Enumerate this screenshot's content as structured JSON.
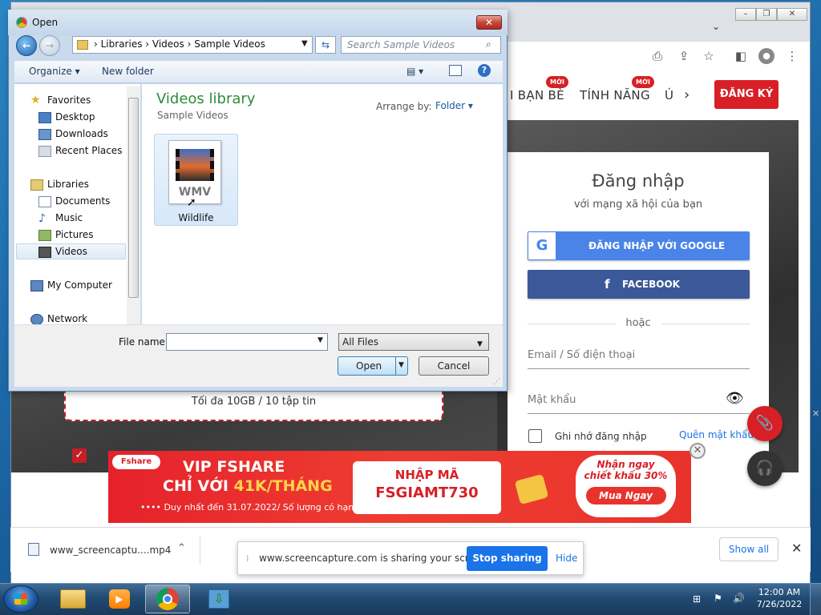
{
  "dialog": {
    "title": "Open",
    "breadcrumb": [
      "Libraries",
      "Videos",
      "Sample Videos"
    ],
    "search_placeholder": "Search Sample Videos",
    "toolbar": {
      "organize": "Organize",
      "new_folder": "New folder"
    },
    "nav": {
      "favorites": "Favorites",
      "fav_items": [
        "Desktop",
        "Downloads",
        "Recent Places"
      ],
      "libraries": "Libraries",
      "lib_items": [
        "Documents",
        "Music",
        "Pictures",
        "Videos"
      ],
      "my_computer": "My Computer",
      "network": "Network"
    },
    "library_title": "Videos library",
    "library_subtitle": "Sample Videos",
    "arrange_by_label": "Arrange by:",
    "arrange_by_value": "Folder",
    "file": {
      "name": "Wildlife",
      "type_badge": "WMV"
    },
    "file_name_label": "File name:",
    "file_name_value": "",
    "file_type_value": "All Files",
    "open_button": "Open",
    "cancel_button": "Cancel"
  },
  "browser": {
    "nav_items": [
      "I BẠN BÈ",
      "TÍNH NĂNG",
      "Ú"
    ],
    "badge_new": "MỚI",
    "signup_button": "ĐĂNG KÝ",
    "login": {
      "title": "Đăng nhập",
      "subtitle": "với mạng xã hội của bạn",
      "google_button": "ĐĂNG NHẬP VỚI GOOGLE",
      "facebook_button": "FACEBOOK",
      "or_text": "hoặc",
      "email_placeholder": "Email / Số điện thoại",
      "password_placeholder": "Mật khẩu",
      "remember_label": "Ghi nhớ đăng nhập",
      "forgot_link": "Quên mật khẩu?"
    },
    "upload_limit": "Tối đa 10GB / 10 tập tin",
    "ad": {
      "brand": "Fshare",
      "line1": "VIP FSHARE",
      "line2_prefix": "CHỈ VỚI ",
      "line2_price": "41K/THÁNG",
      "note": "•••• Duy nhất đến 31.07.2022/ Số lượng có hạn ••••",
      "code_label": "NHẬP MÃ",
      "code": "FSGIAMT730",
      "promo1": "Nhận ngay",
      "promo2": "chiết khấu 30%",
      "buy": "Mua Ngay"
    },
    "download_file": "www_screencaptu....mp4",
    "share_text": "www.screencapture.com is sharing your screen.",
    "stop_sharing": "Stop sharing",
    "hide": "Hide",
    "show_all": "Show all"
  },
  "taskbar": {
    "time": "12:00 AM",
    "date": "7/26/2022"
  },
  "colors": {
    "brand_red": "#d81f26",
    "google_blue": "#4a84e8",
    "facebook_blue": "#3b5998",
    "dialog_title_green": "#2e8b3a"
  }
}
